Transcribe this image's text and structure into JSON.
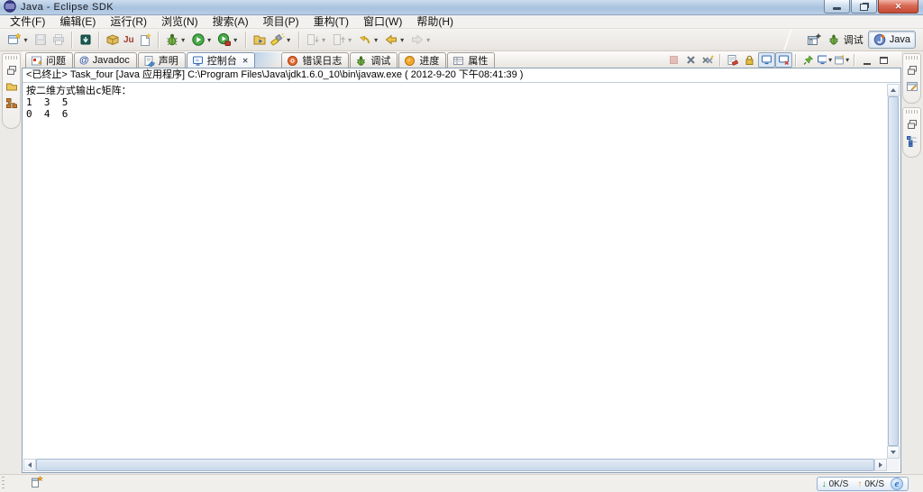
{
  "window": {
    "title": "Java - Eclipse SDK"
  },
  "menu": {
    "items": [
      "文件(F)",
      "编辑(E)",
      "运行(R)",
      "浏览(N)",
      "搜索(A)",
      "项目(P)",
      "重构(T)",
      "窗口(W)",
      "帮助(H)"
    ]
  },
  "perspectives": {
    "debug_label": "调试",
    "java_label": "Java"
  },
  "tabs": [
    {
      "label": "问题"
    },
    {
      "label": "Javadoc"
    },
    {
      "label": "声明"
    },
    {
      "label": "控制台",
      "active": true
    },
    {
      "label": "错误日志"
    },
    {
      "label": "调试"
    },
    {
      "label": "进度"
    },
    {
      "label": "属性"
    }
  ],
  "console": {
    "description": "<已终止> Task_four [Java 应用程序] C:\\Program Files\\Java\\jdk1.6.0_10\\bin\\javaw.exe ( 2012-9-20 下午08:41:39 )",
    "lines": [
      "按二维方式输出c矩阵：",
      "1  3  5",
      "0  4  6"
    ]
  },
  "statusbar": {
    "down_label": "0K/S",
    "up_label": "0K/S"
  },
  "glyphs": {
    "dropdown": "▾",
    "tab_close": "✕",
    "at": "@",
    "junit": "Ju",
    "down_arrow": "↓",
    "up_arrow": "↑",
    "ie": "e",
    "window_close": "✕"
  },
  "colors": {
    "titlebar_blue": "#a9c2de",
    "close_red": "#c44a35",
    "console_border": "#8ba0b6",
    "run_green": "#4aa94a",
    "net_down_green": "#1f9e1f",
    "net_up_orange": "#f0a11a"
  }
}
